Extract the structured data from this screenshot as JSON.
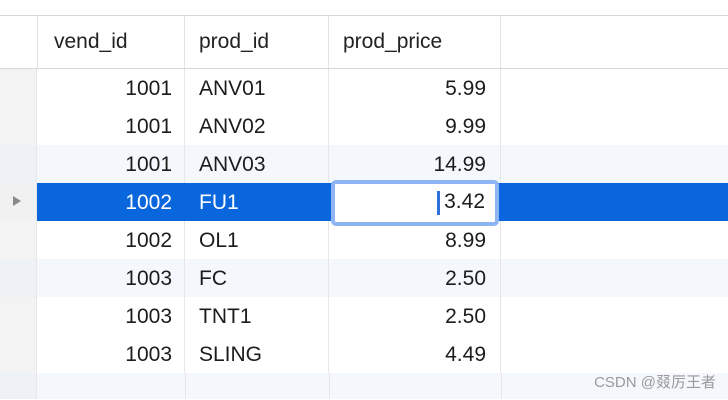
{
  "columns": {
    "vend_id": "vend_id",
    "prod_id": "prod_id",
    "prod_price": "prod_price"
  },
  "rows": [
    {
      "vend_id": "1001",
      "prod_id": "ANV01",
      "prod_price": "5.99"
    },
    {
      "vend_id": "1001",
      "prod_id": "ANV02",
      "prod_price": "9.99"
    },
    {
      "vend_id": "1001",
      "prod_id": "ANV03",
      "prod_price": "14.99"
    },
    {
      "vend_id": "1002",
      "prod_id": "FU1",
      "prod_price": "3.42"
    },
    {
      "vend_id": "1002",
      "prod_id": "OL1",
      "prod_price": "8.99"
    },
    {
      "vend_id": "1003",
      "prod_id": "FC",
      "prod_price": "2.50"
    },
    {
      "vend_id": "1003",
      "prod_id": "TNT1",
      "prod_price": "2.50"
    },
    {
      "vend_id": "1003",
      "prod_id": "SLING",
      "prod_price": "4.49"
    }
  ],
  "selected_row": 3,
  "editor": {
    "value": "3.42"
  },
  "row_indicator_icon": "play-triangle-icon",
  "colors": {
    "selection": "#0a66dc",
    "editor_focus_ring": "#8fb4f3",
    "alt_row": "#f4f7fb"
  },
  "watermark": "CSDN @叕厉王者"
}
